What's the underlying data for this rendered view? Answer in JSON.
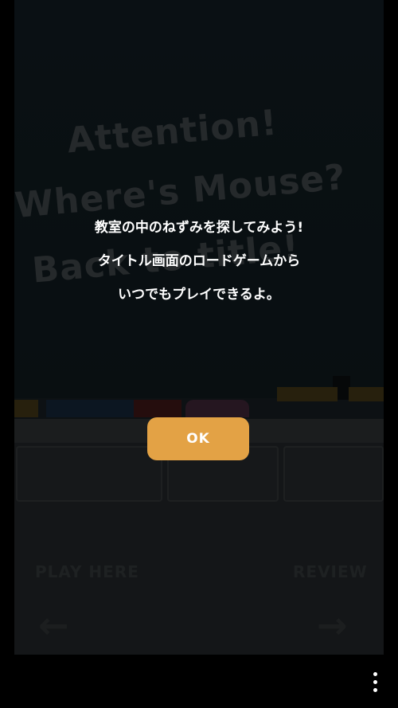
{
  "background_scene": {
    "chalkboard_lines": [
      "Attention!",
      "Where's Mouse?",
      "Back to title!"
    ],
    "left_desk_label": "PLAY HERE",
    "right_desk_label": "REVIEW",
    "left_arrow_icon": "arrow-left-icon",
    "right_arrow_icon": "arrow-right-icon"
  },
  "dialog": {
    "lines": [
      "教室の中のねずみを探してみよう!",
      "タイトル画面のロードゲームから",
      "いつでもプレイできるよ。"
    ],
    "ok_label": "OK",
    "ok_color": "#e3a245"
  },
  "nav": {
    "overflow_icon": "more-vert-icon"
  }
}
